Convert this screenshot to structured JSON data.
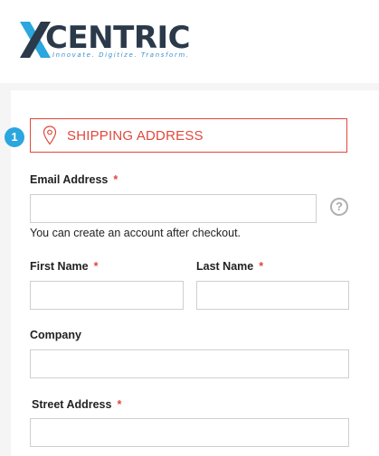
{
  "brand": {
    "name": "CENTRIC",
    "tagline": "Innovate. Digitize. Transform."
  },
  "checkout": {
    "step_number": "1",
    "section_title": "SHIPPING ADDRESS",
    "required_marker": "*",
    "fields": {
      "email": {
        "label": "Email Address",
        "value": "",
        "hint": "You can create an account after checkout.",
        "help_glyph": "?"
      },
      "first_name": {
        "label": "First Name",
        "value": ""
      },
      "last_name": {
        "label": "Last Name",
        "value": ""
      },
      "company": {
        "label": "Company",
        "value": ""
      },
      "street": {
        "label": "Street Address",
        "value": ""
      }
    }
  },
  "colors": {
    "accent_red": "#e0473c",
    "step_blue": "#2ba6de",
    "logo_dark": "#2b3a4a",
    "logo_blue": "#3a8fd0"
  },
  "icons": {
    "logo_mark": "x-logo-icon",
    "section": "map-pin-icon",
    "help": "help-circle-icon"
  }
}
